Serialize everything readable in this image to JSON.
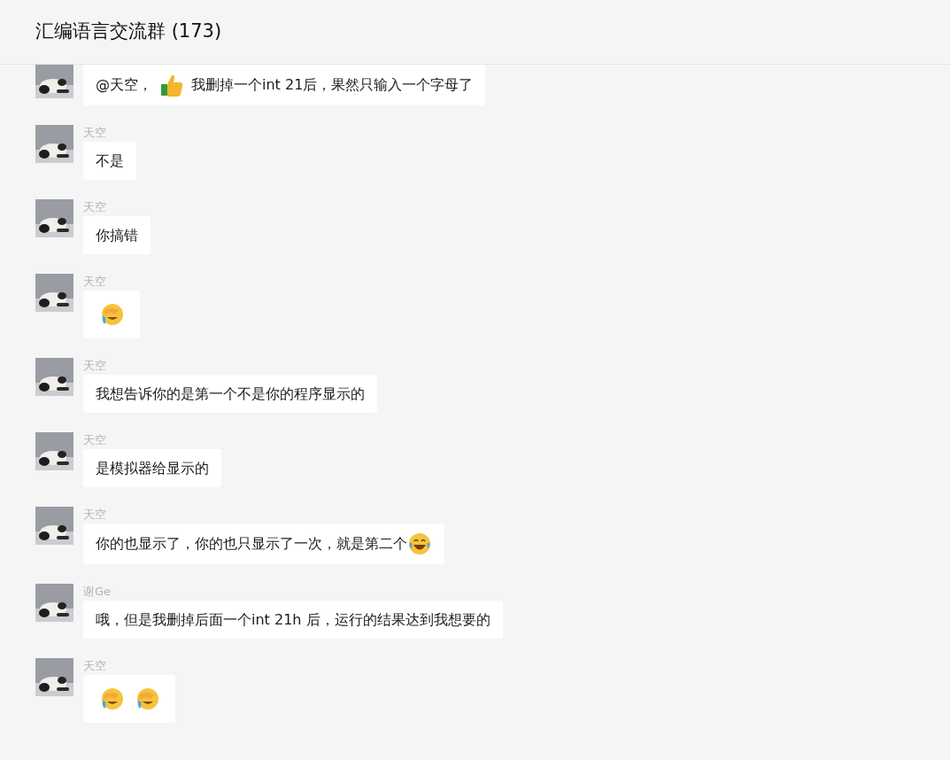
{
  "header": {
    "title": "汇编语言交流群 (173)"
  },
  "messages": [
    {
      "parts": [
        {
          "kind": "text",
          "text": "@天空，"
        },
        {
          "kind": "thumbs"
        },
        {
          "kind": "text",
          "text": "我删掉一个int 21后，果然只输入一个字母了"
        }
      ]
    },
    {
      "sender": "天空",
      "parts": [
        {
          "kind": "text",
          "text": "不是"
        }
      ]
    },
    {
      "sender": "天空",
      "parts": [
        {
          "kind": "text",
          "text": "你搞错"
        }
      ]
    },
    {
      "sender": "天空",
      "parts": [
        {
          "kind": "facepalm"
        }
      ]
    },
    {
      "sender": "天空",
      "parts": [
        {
          "kind": "text",
          "text": "我想告诉你的是第一个不是你的程序显示的"
        }
      ]
    },
    {
      "sender": "天空",
      "parts": [
        {
          "kind": "text",
          "text": "是模拟器给显示的"
        }
      ]
    },
    {
      "sender": "天空",
      "parts": [
        {
          "kind": "text",
          "text": "你的也显示了，你的也只显示了一次，就是第二个"
        },
        {
          "kind": "laugh"
        }
      ]
    },
    {
      "sender": "谢Ge",
      "parts": [
        {
          "kind": "text",
          "text": "哦，但是我删掉后面一个int 21h 后，运行的结果达到我想要的"
        }
      ]
    },
    {
      "sender": "天空",
      "parts": [
        {
          "kind": "facepalm"
        },
        {
          "kind": "facepalm"
        }
      ]
    }
  ]
}
